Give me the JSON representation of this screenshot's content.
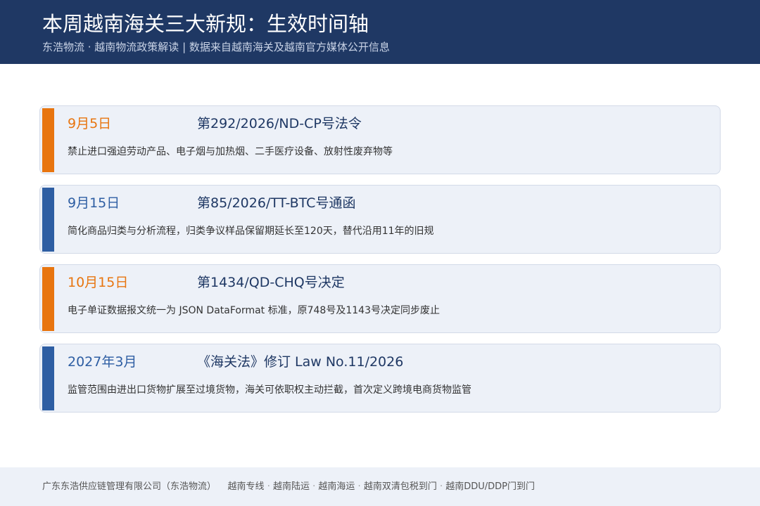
{
  "header": {
    "title": "本周越南海关三大新规：生效时间轴",
    "subtitle": "东浩物流 · 越南物流政策解读 | 数据来自越南海关及越南官方媒体公开信息"
  },
  "colors": {
    "header_bg": "#1f3864",
    "orange": "#e8750f",
    "blue": "#2e5ea3",
    "card_bg": "#edf1f8"
  },
  "timeline": [
    {
      "date": "9月5日",
      "document": "第292/2026/ND-CP号法令",
      "description": "禁止进口强迫劳动产品、电子烟与加热烟、二手医疗设备、放射性废弃物等",
      "accent": "orange"
    },
    {
      "date": "9月15日",
      "document": "第85/2026/TT-BTC号通函",
      "description": "简化商品归类与分析流程，归类争议样品保留期延长至120天，替代沿用11年的旧规",
      "accent": "blue"
    },
    {
      "date": "10月15日",
      "document": "第1434/QD-CHQ号决定",
      "description": "电子单证数据报文统一为 JSON DataFormat 标准，原748号及1143号决定同步废止",
      "accent": "orange"
    },
    {
      "date": "2027年3月",
      "document": "《海关法》修订 Law No.11/2026",
      "description": "监管范围由进出口货物扩展至过境货物，海关可依职权主动拦截，首次定义跨境电商货物监管",
      "accent": "blue"
    }
  ],
  "footer": {
    "company": "广东东浩供应链管理有限公司（东浩物流）",
    "services": [
      "越南专线",
      "越南陆运",
      "越南海运",
      "越南双清包税到门",
      "越南DDU/DDP门到门"
    ]
  }
}
